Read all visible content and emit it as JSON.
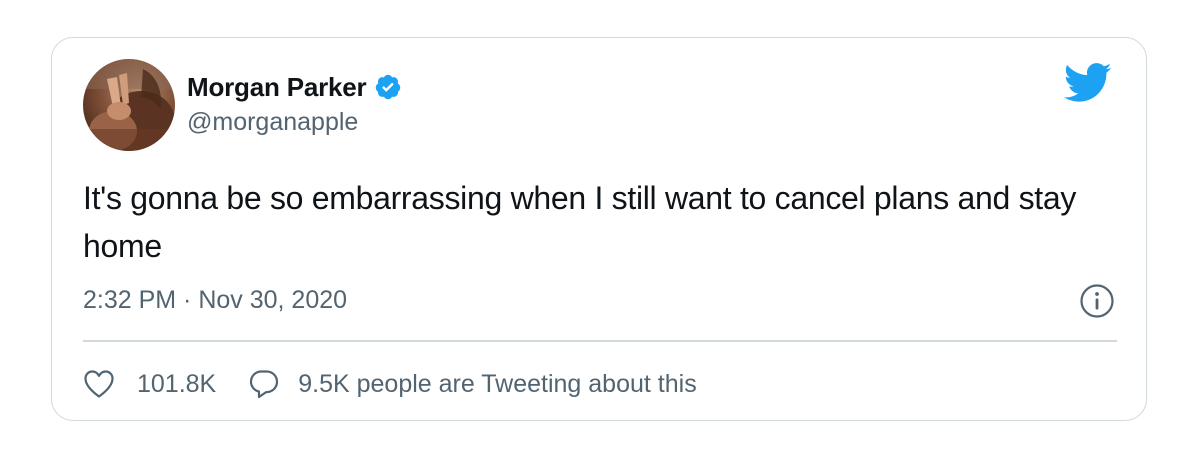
{
  "tweet": {
    "author_name": "Morgan Parker",
    "author_handle": "@morganapple",
    "verified": true,
    "text": "It's gonna be so embarrassing when I still want to cancel plans and stay home",
    "timestamp": "2:32 PM · Nov 30, 2020",
    "likes": "101.8K",
    "conversation": "9.5K people are Tweeting about this"
  },
  "icons": {
    "brand": "twitter-bird-icon",
    "verified": "verified-badge-icon",
    "info": "info-icon",
    "like": "heart-icon",
    "reply": "speech-bubble-icon"
  },
  "colors": {
    "brand_blue": "#1da1f2",
    "text_primary": "#0f1419",
    "text_secondary": "#536471",
    "border": "#cfd9de"
  }
}
